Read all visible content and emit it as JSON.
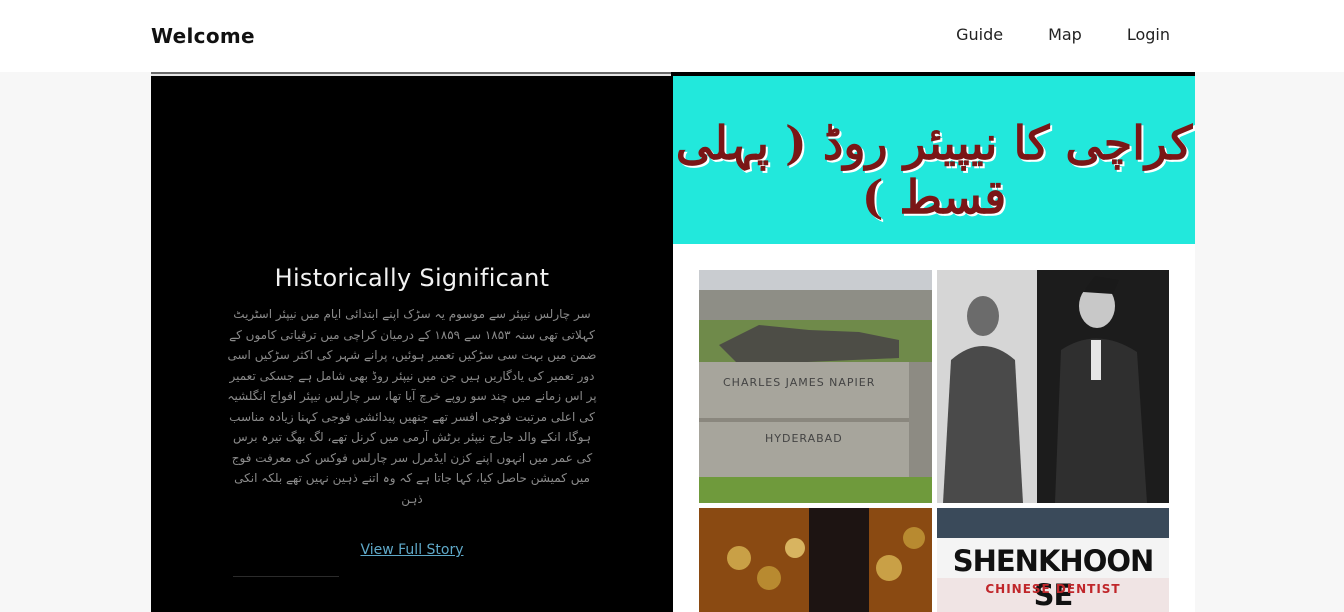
{
  "nav": {
    "brand": "Welcome",
    "links": [
      "Guide",
      "Map",
      "Login"
    ]
  },
  "story": {
    "title": "Historically Significant",
    "body": "سر چارلس نیپئر سے موسوم یہ سڑک اپنے ابتدائی ایام میں نیپئر اسٹریٹ کہلاتی تھی سنہ ۱۸۵۳ سے ۱۸۵۹ کے درمیان کراچی میں ترقیاتی کاموں کے ضمن میں بہت سی سڑکیں تعمیر ہوئیں، پرانے شہر کی اکثر سڑکیں اسی دور تعمیر کی یادگاریں ہیں جن میں نیپئر روڈ بھی شامل ہے جسکی تعمیر پر اس زمانے میں چند سو روپے خرچ آیا تھا، سر چارلس نیپئر افواج انگلشیہ کی اعلی مرتبت فوجی افسر تھے جنھیں پیدائشی فوجی کہنا زیادہ مناسب ہوگا، انکے والد جارج نیپئر برٹش آرمی میں کرنل تھے، لگ بھگ تیرہ برس کی عمر میں انہوں اپنے کزن ایڈمرل سر چارلس فوکس کی معرفت فوج میں کمیشن حاصل کیا، کہا جاتا ہے کہ وہ اتنے ذہین نہیں تھے بلکہ انکی ذہن",
    "link_label": "View Full Story"
  },
  "feature": {
    "banner_text": "کراچی کا نیپیئر روڈ ( پہلی قسط )",
    "statue_plinth_top": "CHARLES JAMES NAPIER",
    "statue_plinth_bottom": "HYDERABAD",
    "sign_main": "SHENKHOON SE",
    "sign_sub": "CHINESE DENTIST"
  },
  "colors": {
    "banner_bg": "#22e8dc",
    "banner_text": "#7a1616",
    "link": "#5fa9c9"
  }
}
